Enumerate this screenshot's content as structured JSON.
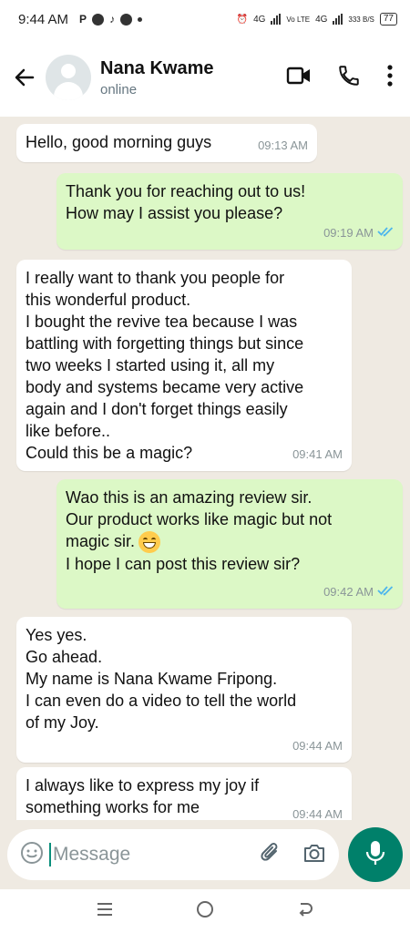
{
  "status_bar": {
    "time": "9:44 AM",
    "left_glyph": "P",
    "network_left": "4G",
    "volte": "Vo LTE",
    "network_right": "4G",
    "speed": "333 B/S",
    "battery": "77"
  },
  "header": {
    "contact_name": "Nana Kwame",
    "status": "online"
  },
  "messages": [
    {
      "dir": "in",
      "text": "Hello, good morning guys",
      "time": "09:13 AM"
    },
    {
      "dir": "out",
      "text": "Thank you for reaching out to us!\nHow may I assist you please?",
      "time": "09:19 AM",
      "read": true
    },
    {
      "dir": "in",
      "text": "I really want to thank you people for\nthis wonderful product.\nI bought the revive tea because I was\nbattling with forgetting things but since\ntwo weeks I started using it, all my\nbody and systems became very active\nagain and I don't forget things easily\nlike before..\nCould this be a magic?",
      "time": "09:41 AM"
    },
    {
      "dir": "out",
      "text_a": "Wao this is an amazing review sir.\nOur product works like magic  but not\nmagic sir.",
      "text_b": "I hope I can post this review sir?",
      "time": "09:42 AM",
      "read": true
    },
    {
      "dir": "in",
      "text": "Yes yes.\nGo ahead.\nMy name is Nana Kwame Fripong.\nI can even do a video to tell the world\nof my Joy.",
      "time": "09:44 AM"
    },
    {
      "dir": "in",
      "text": "I always like to express my joy if\nsomething works for me",
      "time": "09:44 AM"
    }
  ],
  "composer": {
    "placeholder": "Message"
  },
  "colors": {
    "outgoing_bubble": "#dcf8c6",
    "incoming_bubble": "#ffffff",
    "accent": "#00806a",
    "read_ticks": "#4fb6ec"
  },
  "icons": [
    "back-arrow-icon",
    "video-call-icon",
    "phone-icon",
    "more-vert-icon",
    "emoji-icon",
    "attach-icon",
    "camera-icon",
    "mic-icon",
    "double-check-icon"
  ]
}
